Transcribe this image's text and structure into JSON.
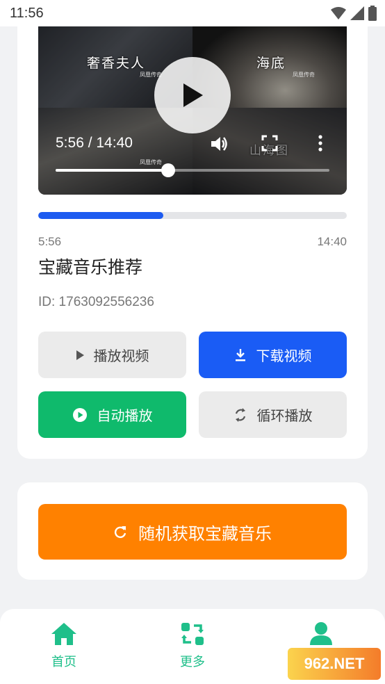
{
  "status_bar": {
    "time": "11:56"
  },
  "video": {
    "poster_titles": [
      "奢香夫人",
      "海底",
      "山海图"
    ],
    "poster_small": [
      "凤凰传奇",
      "凤凰传奇",
      "凤凰传奇"
    ],
    "time_label": "5:56 / 14:40",
    "seek_fraction": 0.41
  },
  "progress": {
    "fraction": 0.405,
    "current": "5:56",
    "total": "14:40"
  },
  "title": "宝藏音乐推荐",
  "video_id": "ID: 1763092556236",
  "buttons": {
    "play": "播放视频",
    "download": "下载视频",
    "autoplay": "自动播放",
    "loop": "循环播放"
  },
  "random_button": "随机获取宝藏音乐",
  "nav": {
    "home": "首页",
    "more": "更多"
  },
  "watermark": "962.NET",
  "colors": {
    "blue": "#1a5cf5",
    "green": "#0fba6c",
    "orange": "#ff8100",
    "nav_accent": "#1fbf8a"
  }
}
